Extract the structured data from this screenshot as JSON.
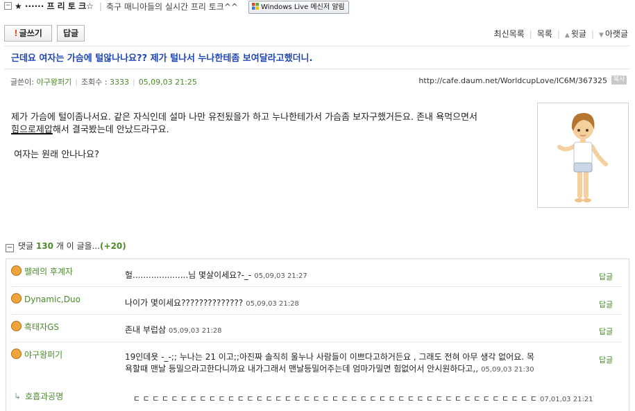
{
  "header": {
    "title": "★ ······ 프 리 토 크☆",
    "separator": "|",
    "description": "축구 매니아들의 실시간 프리 토크^^",
    "windows_live_button": "Windows Live 메신저 알림"
  },
  "toolbar": {
    "write_label": "글쓰기",
    "write_mark": "!",
    "reply_label": "답글",
    "nav": {
      "recent_list": "최신목록",
      "list": "목록",
      "prev": "윗글",
      "next": "아랫글"
    }
  },
  "post": {
    "subject": "근데요 여자는 가슴에 털않나나요?? 제가 털나서 누나한테좀 보여달라고했더니.",
    "author_label": "글쓴이:",
    "author": "야구왕퍼기",
    "views_label": "조회수 :",
    "views": "3333",
    "date": "05,09,03 21:25",
    "url": "http://cafe.daum.net/WorldcupLove/IC6M/367325",
    "copy_badge": "복사",
    "body_line1": "제가 가슴에 털이좀나서요. 같은 자식인데 설마 나만 유전됬을가 하고 누나한테가서 가슴좀 보자구했거든요.  존내 욕먹으면서",
    "body_line2_underlined": "힘으로제압",
    "body_line2_rest": "해서 결국봤는데 안났드라구요.",
    "body_line3": " 여자는 원래 안나나요?"
  },
  "comments": {
    "label_prefix": "댓글",
    "count": "130",
    "label_suffix": "개 이 글을...",
    "plus": "(+20)",
    "reply_label": "답글",
    "items": [
      {
        "name": "펠레의 후계자",
        "text": "헐.....................님 몇살이세요?-_-",
        "date": "05,09,03 21:27"
      },
      {
        "name": "Dynamic,Duo",
        "text": "나이가 몇이세요??????????????",
        "date": "05,09,03 21:28"
      },
      {
        "name": "흑태자GS",
        "text": "존내 부럽삼",
        "date": "05,09,03 21:28"
      },
      {
        "name": "야구왕퍼기",
        "text": "19인데욧 -_-;; 누나는 21 이고;;아진짜 솔직히 울누나 사람들이 이쁘다고하거든요 , 그래도 전혀 아무 생각 없어요. 목욕할때 맨날 등밀으라고한다니까요 내가그래서 맨날등밀어주는데 엄마가밀면 힘없어서 안시원하다고,,",
        "date": "05,09,03 21:30"
      }
    ],
    "subreply": {
      "arrow": "↳",
      "name": "호흡과공명",
      "text": "ㄷ ㄷ ㄷ ㄷ ㄷ ㄷ ㄷ ㄷ ㄷ ㄷ ㄷ ㄷ ㄷ ㄷ ㄷ ㄷ ㄷ ㄷ ㄷ ㄷ ㄷ ㄷ ㄷ ㄷ ㄷ ㄷ ㄷ ㄷ ㄷ ㄷ ㄷ ㄷ ㄷ ㄷ ㄷ ㄷ ㄷ ㄷ ㄷ ㄷ ㄷ ㄷ ㄷ",
      "date": "07,01,03 21:21"
    }
  }
}
